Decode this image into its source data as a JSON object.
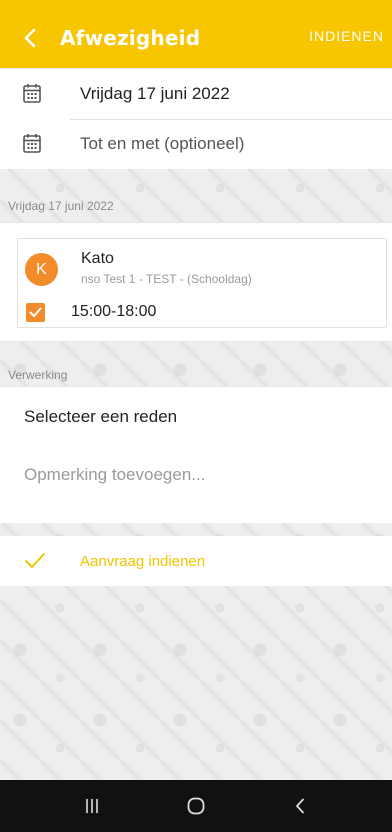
{
  "header": {
    "title": "Afwezigheid",
    "submit_label": "INDIENEN"
  },
  "dates": {
    "from_value": "Vrijdag 17 juni 2022",
    "until_placeholder": "Tot en met (optioneel)"
  },
  "day_section": {
    "label": "Vrijdag 17 juni 2022"
  },
  "child": {
    "initial": "K",
    "name": "Kato",
    "group": "nso Test 1 - TEST - (Schooldag)",
    "time": "15:00-18:00",
    "checked": true
  },
  "processing": {
    "label": "Verwerking",
    "reason_label": "Selecteer een reden",
    "remark_placeholder": "Opmerking toevoegen..."
  },
  "submit": {
    "label": "Aanvraag indienen"
  },
  "colors": {
    "brand_yellow": "#f7c600",
    "accent_orange": "#f28b2a"
  },
  "icons": {
    "back": "chevron-left-icon",
    "calendar": "calendar-icon",
    "check": "checkmark-icon",
    "nav_recent": "recent-apps-icon",
    "nav_home": "home-icon",
    "nav_back": "back-icon"
  }
}
